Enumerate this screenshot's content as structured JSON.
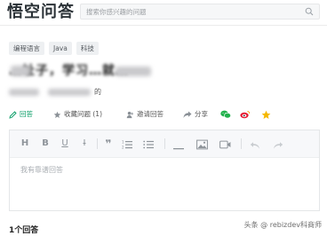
{
  "header": {
    "logo_text": "悟空问答",
    "search_placeholder": "搜索你感兴趣的问题"
  },
  "tags": [
    "编程语言",
    "Java",
    "科技"
  ],
  "question": {
    "title_visible": "…址子，学习…就…",
    "subtitle_suffix": "的"
  },
  "actions": {
    "answer": "回答",
    "favorite": "收藏问题 (1)",
    "invite": "邀请回答",
    "share": "分享"
  },
  "editor": {
    "placeholder": "我有靠谱回答"
  },
  "answers_count": "1个回答",
  "watermark": "头条 @ rebizdev科商师",
  "colors": {
    "accent": "#009a61",
    "wechat": "#22b14c",
    "weibo": "#e6162d",
    "star": "#f5b800"
  }
}
